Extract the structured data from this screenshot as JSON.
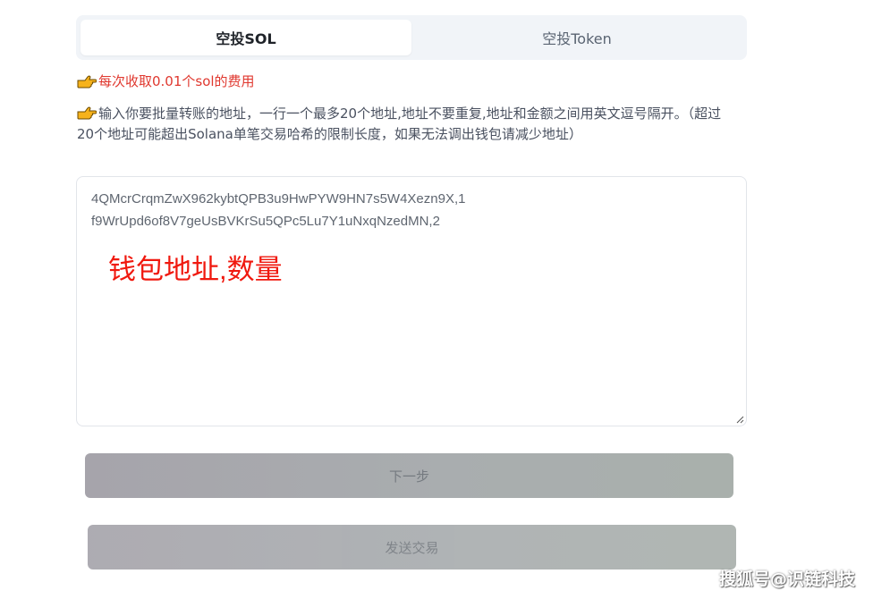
{
  "tabs": [
    {
      "label": "空投SOL",
      "active": true
    },
    {
      "label": "空投Token",
      "active": false
    }
  ],
  "notices": {
    "fee": "每次收取0.01个sol的费用",
    "info": "输入你要批量转账的地址，一行一个最多20个地址,地址不要重复,地址和金额之间用英文逗号隔开。（超过20个地址可能超出Solana单笔交易哈希的限制长度，如果无法调出钱包请减少地址）"
  },
  "addresses": {
    "lines": [
      "4QMcrCrqmZwX962kybtQPB3u9HwPYW9HN7s5W4Xezn9X,1",
      "f9WrUpd6of8V7geUsBVKrSu5QPc5Lu7Y1uNxqNzedMN,2"
    ],
    "overlay_label": "钱包地址,数量"
  },
  "buttons": {
    "next": "下一步",
    "send": "发送交易"
  },
  "watermark": "搜狐号@识链科技",
  "icons": {
    "pointing_hand": "pointing-hand-icon",
    "resize": "resize-grip-icon"
  },
  "colors": {
    "fee_text": "#e0382f",
    "overlay_label": "#f0190f",
    "tab_bar": "#f1f4f8",
    "button_start": "#a6a4ab",
    "button_end": "#a9b0ac"
  }
}
